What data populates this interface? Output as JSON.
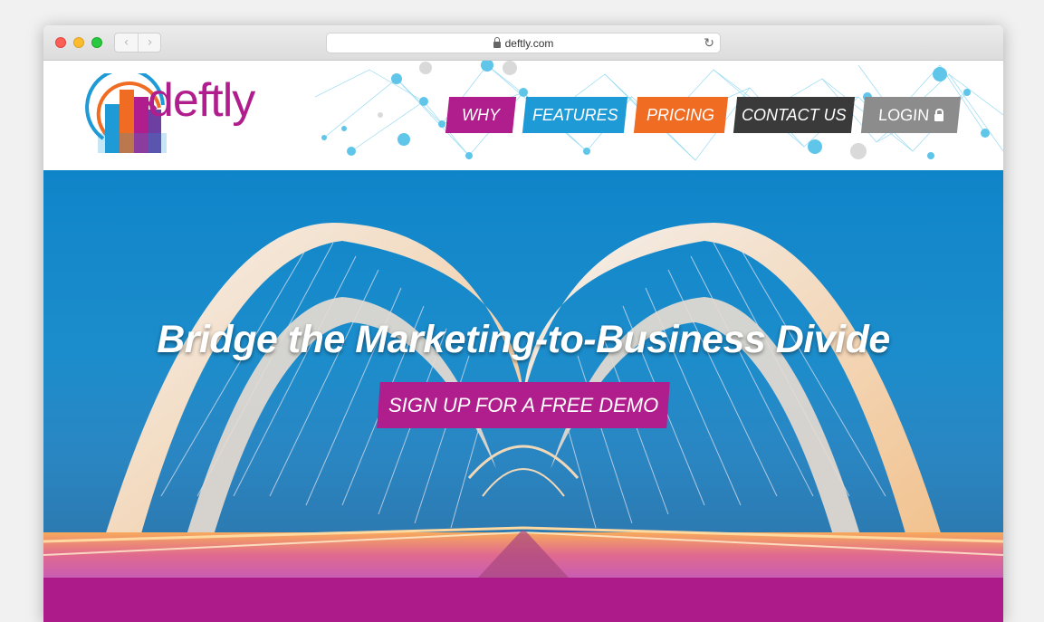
{
  "browser": {
    "url": "deftly.com",
    "back_icon": "chevron-left-icon",
    "forward_icon": "chevron-right-icon",
    "reload_icon": "reload-icon"
  },
  "header": {
    "logo_text": "deftly",
    "nav": [
      {
        "label": "WHY",
        "color": "#b01d8c"
      },
      {
        "label": "FEATURES",
        "color": "#1e9ad6"
      },
      {
        "label": "PRICING",
        "color": "#ef6c22"
      },
      {
        "label": "CONTACT US",
        "color": "#3a3a3a"
      },
      {
        "label": "LOGIN",
        "color": "#8c8c8c",
        "icon": "lock-icon"
      }
    ]
  },
  "hero": {
    "headline": "Bridge the Marketing-to-Business Divide",
    "cta_label": "SIGN UP FOR A FREE DEMO"
  },
  "colors": {
    "brand_magenta": "#b01d8c",
    "brand_blue": "#1e9ad6",
    "brand_orange": "#ef6c22"
  }
}
